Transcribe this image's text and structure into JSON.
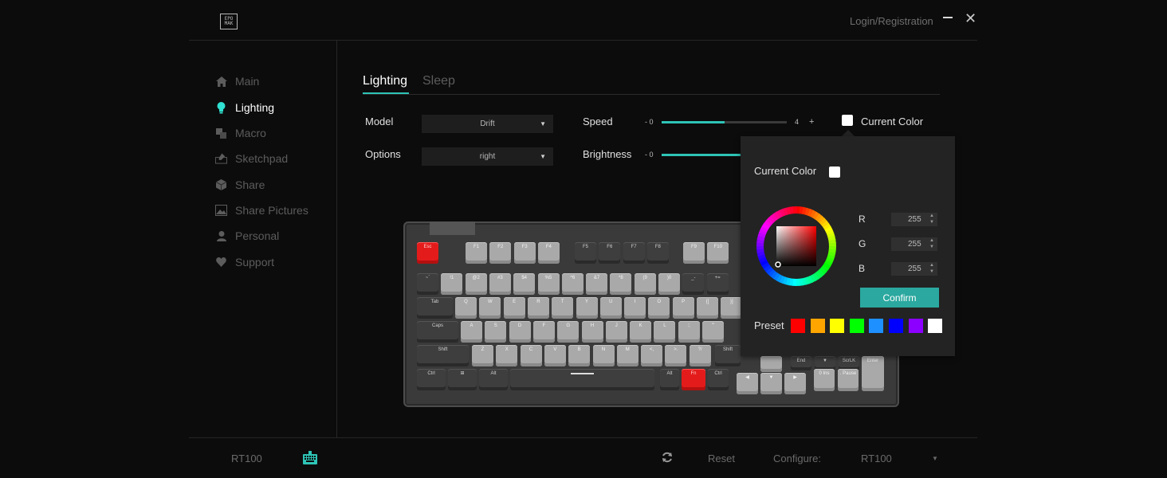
{
  "header": {
    "logo_text": "EPOMAKER",
    "login": "Login/Registration"
  },
  "icons": {
    "logo": "epomaker-logo-icon",
    "minimize": "minimize-icon",
    "close": "close-icon",
    "main": "home-icon",
    "lighting": "lightbulb-icon",
    "macro": "macro-icon",
    "sketchpad": "keyboard-draw-icon",
    "share": "cube-icon",
    "share_pictures": "image-icon",
    "personal": "person-icon",
    "support": "heart-icon",
    "refresh": "refresh-icon",
    "keyboard_device": "keyboard-icon",
    "dropdown": "caret-down-icon"
  },
  "sidebar": {
    "items": [
      {
        "label": "Main"
      },
      {
        "label": "Lighting"
      },
      {
        "label": "Macro"
      },
      {
        "label": "Sketchpad"
      },
      {
        "label": "Share"
      },
      {
        "label": "Share Pictures"
      },
      {
        "label": "Personal"
      },
      {
        "label": "Support"
      }
    ],
    "active_index": 1
  },
  "tabs": [
    {
      "label": "Lighting"
    },
    {
      "label": "Sleep"
    }
  ],
  "controls": {
    "model_label": "Model",
    "model_value": "Drift",
    "options_label": "Options",
    "options_value": "right",
    "speed_label": "Speed",
    "speed_min": "- 0",
    "speed_max": "4",
    "speed_plus": "+",
    "speed_level": 0.5,
    "brightness_label": "Brightness",
    "brightness_min": "- 0",
    "current_color_label": "Current Color",
    "current_color": "#ffffff"
  },
  "popup": {
    "current_color_label": "Current Color",
    "r_label": "R",
    "g_label": "G",
    "b_label": "B",
    "r": "255",
    "g": "255",
    "b": "255",
    "confirm": "Confirm",
    "preset_label": "Preset",
    "presets": [
      "#ff0000",
      "#ffa500",
      "#ffff00",
      "#00ff00",
      "#1e90ff",
      "#0000ff",
      "#8b00ff",
      "#ffffff"
    ]
  },
  "keyboard": {
    "keys": {
      "esc": "Esc",
      "f1": "F1",
      "f2": "F2",
      "f3": "F3",
      "f4": "F4",
      "f5": "F5",
      "f6": "F6",
      "f7": "F7",
      "f8": "F8",
      "f9": "F9",
      "f10": "F10",
      "tab": "Tab",
      "caps": "Caps",
      "shift": "Shift",
      "rshift": "Shift",
      "ctrl": "Ctrl",
      "alt": "Alt",
      "ralt": "Alt",
      "fn": "Fn",
      "rctrl": "Ctrl",
      "enter": "Enter",
      "end": "End",
      "scrlk": "ScrLK",
      "ins": "Ins",
      "pause": "Pause",
      "ins_num": "0",
      "pause_sym": "."
    },
    "num_row": [
      "~`",
      "!1",
      "@2",
      "#3",
      "$4",
      "%5",
      "^6",
      "&7",
      "*8",
      "(9",
      ")0",
      "_-",
      "+="
    ],
    "top_row": [
      "Q",
      "W",
      "E",
      "R",
      "T",
      "Y",
      "U",
      "I",
      "O",
      "P",
      "{[",
      "}]"
    ],
    "home_row": [
      "A",
      "S",
      "D",
      "F",
      "G",
      "H",
      "J",
      "K",
      "L",
      ":;",
      "\"'"
    ],
    "bottom_row": [
      "Z",
      "X",
      "C",
      "V",
      "B",
      "N",
      "M",
      "<,",
      ">.",
      "?/"
    ]
  },
  "footer": {
    "device": "RT100",
    "reset": "Reset",
    "configure_label": "Configure:",
    "configure_value": "RT100"
  }
}
